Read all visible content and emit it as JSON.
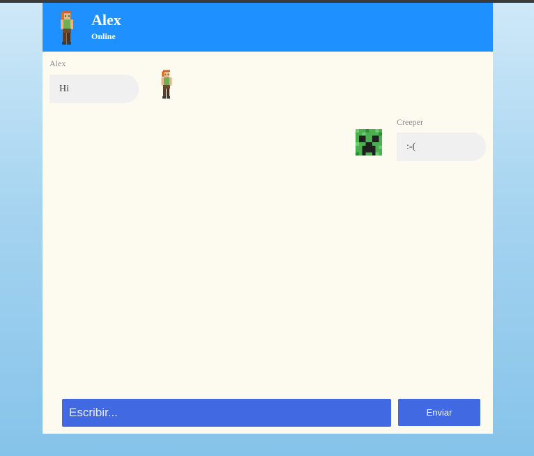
{
  "header": {
    "avatar_icon": "alex-avatar-icon",
    "name": "Alex",
    "status": "Online",
    "background_color": "#1e90ff"
  },
  "messages": [
    {
      "sender": "Alex",
      "text": "Hi",
      "avatar_icon": "alex-avatar-icon"
    },
    {
      "sender": "Creeper",
      "text": ":-(",
      "avatar_icon": "creeper-avatar-icon"
    }
  ],
  "composer": {
    "placeholder": "Escribir...",
    "value": "",
    "send_label": "Enviar",
    "accent_color": "#4169e1"
  }
}
